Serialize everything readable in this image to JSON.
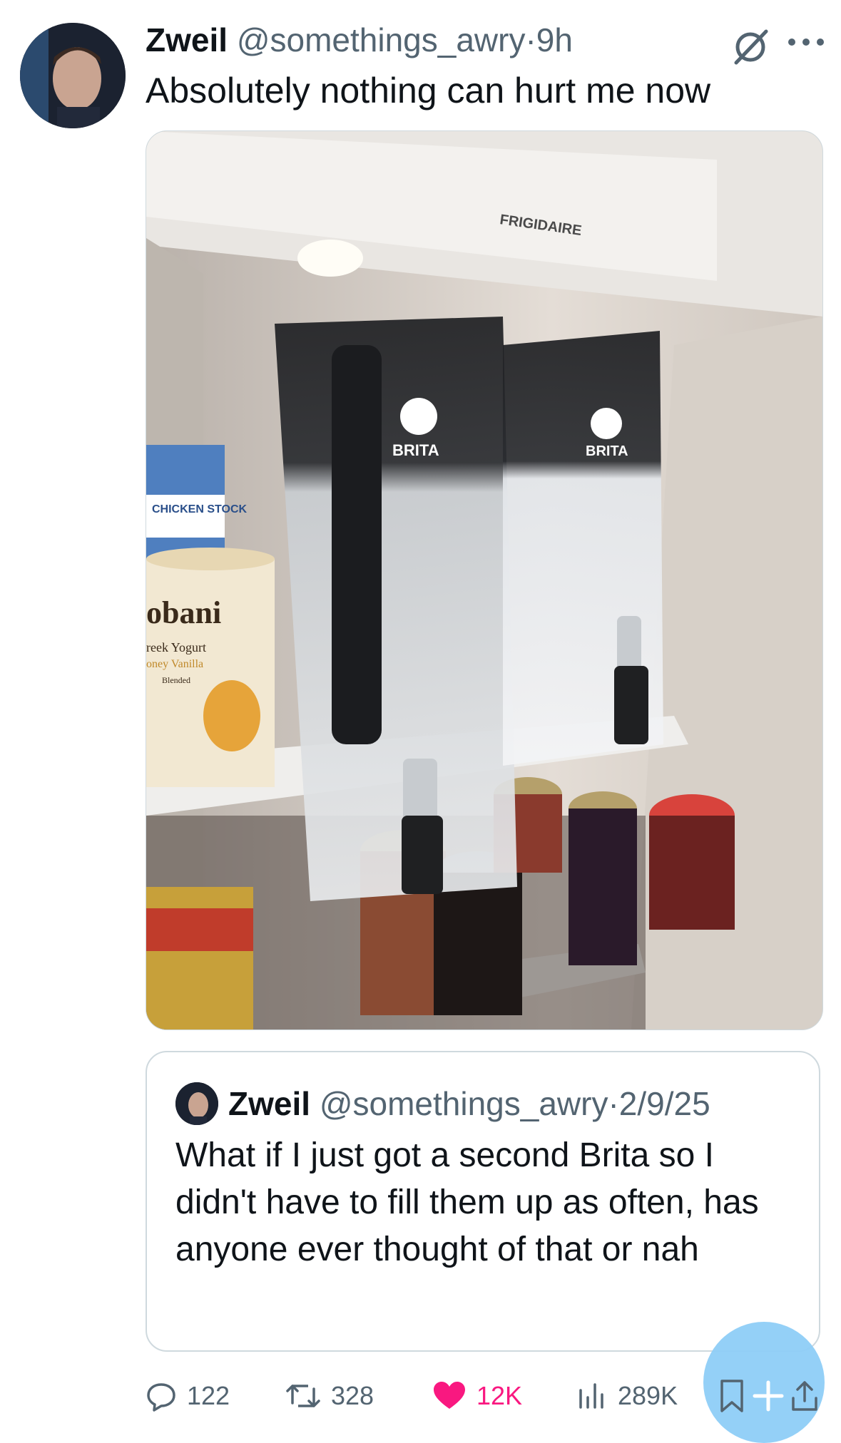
{
  "tweet": {
    "display_name": "Zweil",
    "handle": "@somethings_awry",
    "separator": "·",
    "time": "9h",
    "text": "Absolutely nothing can hurt me now",
    "more_icon": "more-horizontal-icon",
    "grok_icon": "grok-icon"
  },
  "media": {
    "brand_fridge": "FRIGIDAIRE",
    "brand_pitcher_1": "BRITA",
    "brand_pitcher_2": "BRITA",
    "carton_label": "CHICKEN STOCK",
    "yogurt_brand": "obani",
    "yogurt_sub1": "reek Yogurt",
    "yogurt_sub2": "oney Vanilla",
    "yogurt_sub3": "Blended"
  },
  "quote": {
    "display_name": "Zweil",
    "handle": "@somethings_awry",
    "separator": "·",
    "date": "2/9/25",
    "text": "What if I just got a second Brita so I didn't have to fill them up as often, has anyone ever thought of that or nah"
  },
  "actions": {
    "replies": "122",
    "reposts": "328",
    "likes": "12K",
    "views": "289K",
    "colors": {
      "like": "#f91880",
      "muted": "#536471",
      "fab": "#8ecdf7"
    }
  }
}
